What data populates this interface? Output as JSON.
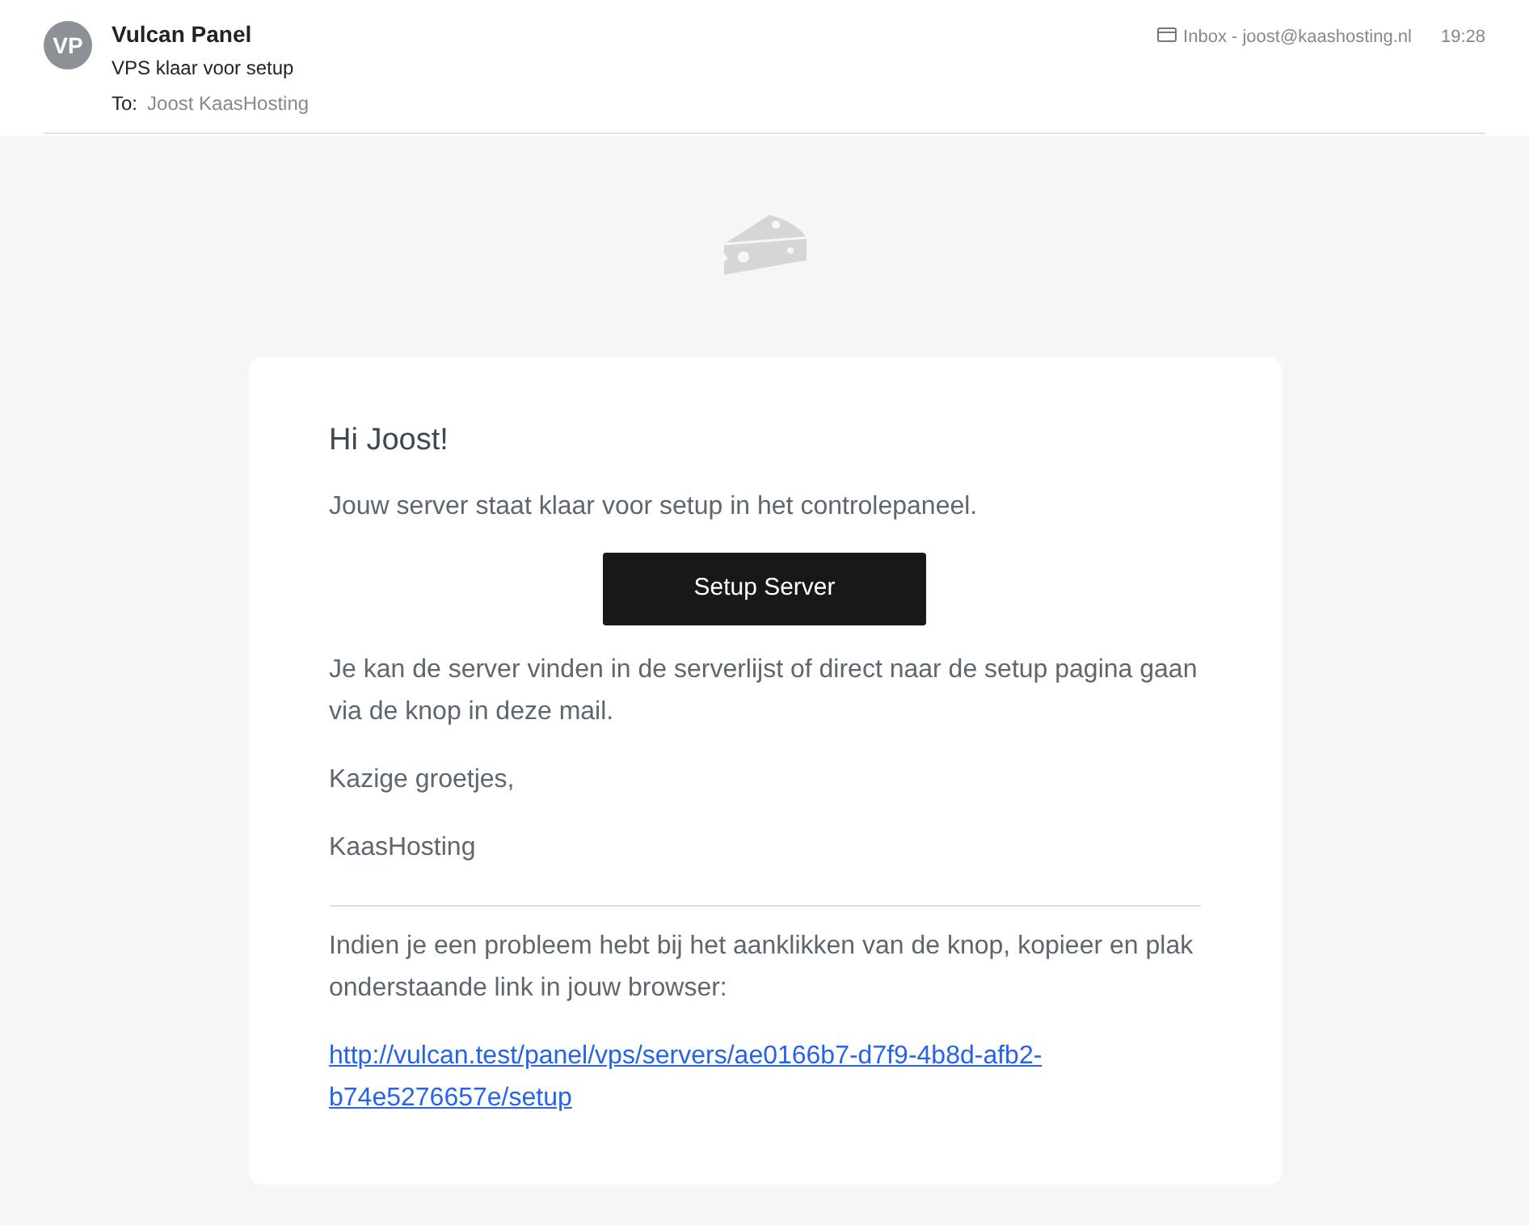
{
  "header": {
    "avatar": "VP",
    "sender": "Vulcan Panel",
    "subject": "VPS klaar voor setup",
    "to_label": "To:",
    "to": "Joost KaasHosting",
    "mailbox": "Inbox - joost@kaashosting.nl",
    "time": "19:28"
  },
  "email": {
    "greeting": "Hi Joost!",
    "intro": "Jouw server staat klaar voor setup in het controlepaneel.",
    "button": "Setup Server",
    "body": [
      "Je kan de server vinden in de serverlijst of direct naar de setup pagina gaan via de knop in deze mail.",
      "Kazige groetjes,",
      "KaasHosting"
    ],
    "footer_text": "Indien je een probleem hebt bij het aanklikken van de knop, kopieer en plak onderstaande link in jouw browser:",
    "link": "http://vulcan.test/panel/vps/servers/ae0166b7-d7f9-4b8d-afb2-b74e5276657e/setup"
  }
}
